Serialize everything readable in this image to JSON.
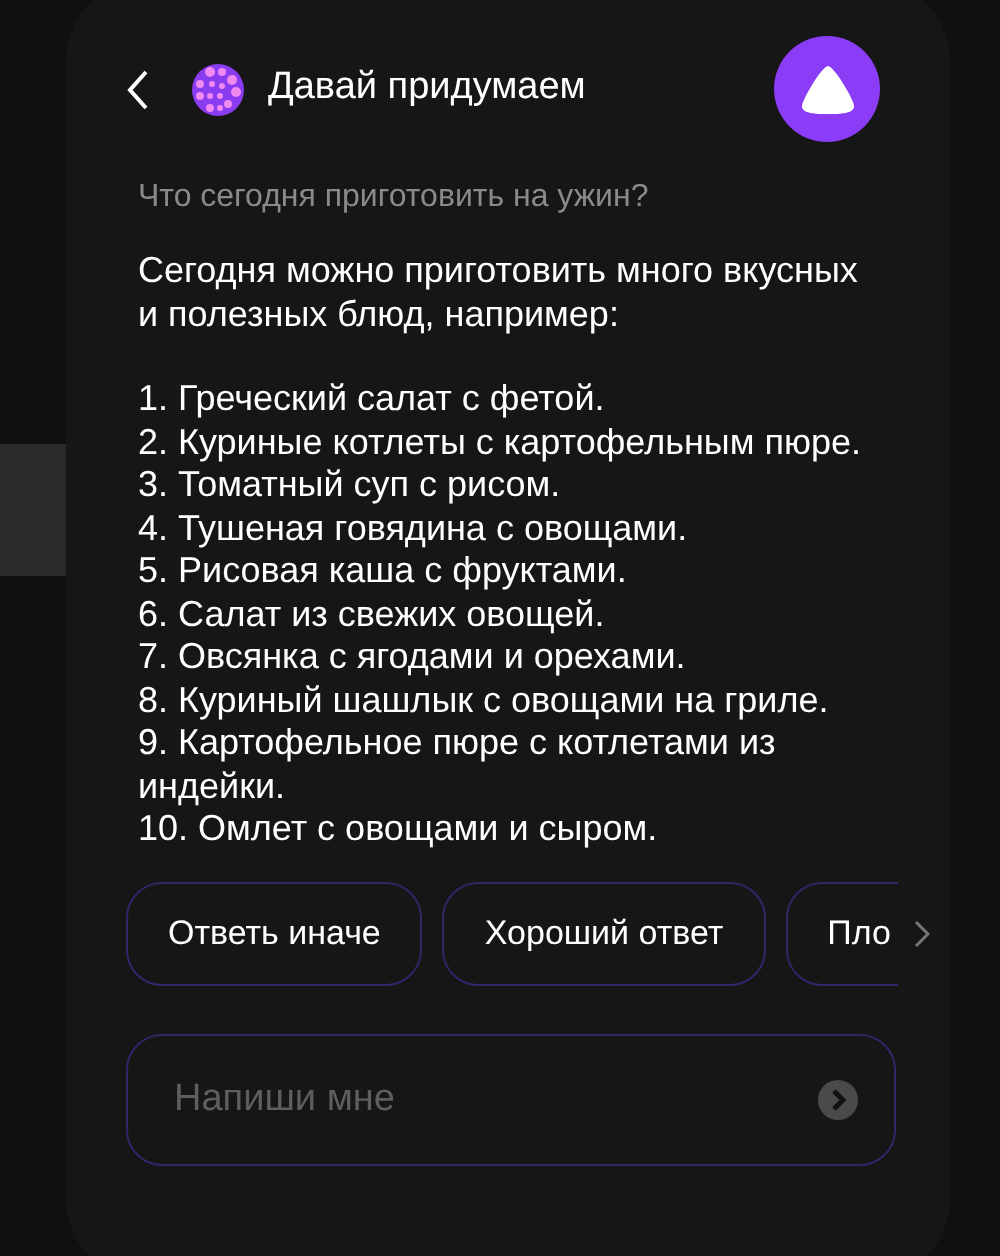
{
  "header": {
    "title": "Давай придумаем"
  },
  "question": "Что сегодня приготовить на ужин?",
  "answer": {
    "intro": "Сегодня можно приготовить много вкусных и полезных блюд, например:",
    "items": [
      "1. Греческий салат с фетой.",
      "2. Куриные котлеты с картофельным пюре.",
      "3. Томатный суп с рисом.",
      "4. Тушеная говядина с овощами.",
      "5. Рисовая каша с фруктами.",
      "6. Салат из свежих овощей.",
      "7. Овсянка с ягодами и орехами.",
      "8. Куриный шашлык с овощами на гриле.",
      "9. Картофельное пюре с котлетами из индейки.",
      "10. Омлет с овощами и сыром."
    ]
  },
  "chips": [
    "Ответь иначе",
    "Хороший ответ",
    "Пло"
  ],
  "input": {
    "placeholder": "Напиши мне"
  }
}
